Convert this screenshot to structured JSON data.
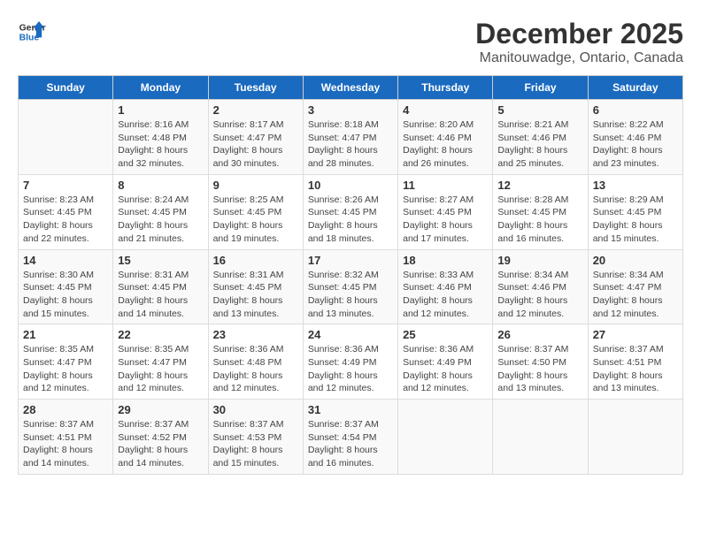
{
  "header": {
    "logo_line1": "General",
    "logo_line2": "Blue",
    "title": "December 2025",
    "subtitle": "Manitouwadge, Ontario, Canada"
  },
  "calendar": {
    "days_of_week": [
      "Sunday",
      "Monday",
      "Tuesday",
      "Wednesday",
      "Thursday",
      "Friday",
      "Saturday"
    ],
    "weeks": [
      [
        {
          "day": "",
          "info": ""
        },
        {
          "day": "1",
          "info": "Sunrise: 8:16 AM\nSunset: 4:48 PM\nDaylight: 8 hours\nand 32 minutes."
        },
        {
          "day": "2",
          "info": "Sunrise: 8:17 AM\nSunset: 4:47 PM\nDaylight: 8 hours\nand 30 minutes."
        },
        {
          "day": "3",
          "info": "Sunrise: 8:18 AM\nSunset: 4:47 PM\nDaylight: 8 hours\nand 28 minutes."
        },
        {
          "day": "4",
          "info": "Sunrise: 8:20 AM\nSunset: 4:46 PM\nDaylight: 8 hours\nand 26 minutes."
        },
        {
          "day": "5",
          "info": "Sunrise: 8:21 AM\nSunset: 4:46 PM\nDaylight: 8 hours\nand 25 minutes."
        },
        {
          "day": "6",
          "info": "Sunrise: 8:22 AM\nSunset: 4:46 PM\nDaylight: 8 hours\nand 23 minutes."
        }
      ],
      [
        {
          "day": "7",
          "info": "Sunrise: 8:23 AM\nSunset: 4:45 PM\nDaylight: 8 hours\nand 22 minutes."
        },
        {
          "day": "8",
          "info": "Sunrise: 8:24 AM\nSunset: 4:45 PM\nDaylight: 8 hours\nand 21 minutes."
        },
        {
          "day": "9",
          "info": "Sunrise: 8:25 AM\nSunset: 4:45 PM\nDaylight: 8 hours\nand 19 minutes."
        },
        {
          "day": "10",
          "info": "Sunrise: 8:26 AM\nSunset: 4:45 PM\nDaylight: 8 hours\nand 18 minutes."
        },
        {
          "day": "11",
          "info": "Sunrise: 8:27 AM\nSunset: 4:45 PM\nDaylight: 8 hours\nand 17 minutes."
        },
        {
          "day": "12",
          "info": "Sunrise: 8:28 AM\nSunset: 4:45 PM\nDaylight: 8 hours\nand 16 minutes."
        },
        {
          "day": "13",
          "info": "Sunrise: 8:29 AM\nSunset: 4:45 PM\nDaylight: 8 hours\nand 15 minutes."
        }
      ],
      [
        {
          "day": "14",
          "info": "Sunrise: 8:30 AM\nSunset: 4:45 PM\nDaylight: 8 hours\nand 15 minutes."
        },
        {
          "day": "15",
          "info": "Sunrise: 8:31 AM\nSunset: 4:45 PM\nDaylight: 8 hours\nand 14 minutes."
        },
        {
          "day": "16",
          "info": "Sunrise: 8:31 AM\nSunset: 4:45 PM\nDaylight: 8 hours\nand 13 minutes."
        },
        {
          "day": "17",
          "info": "Sunrise: 8:32 AM\nSunset: 4:45 PM\nDaylight: 8 hours\nand 13 minutes."
        },
        {
          "day": "18",
          "info": "Sunrise: 8:33 AM\nSunset: 4:46 PM\nDaylight: 8 hours\nand 12 minutes."
        },
        {
          "day": "19",
          "info": "Sunrise: 8:34 AM\nSunset: 4:46 PM\nDaylight: 8 hours\nand 12 minutes."
        },
        {
          "day": "20",
          "info": "Sunrise: 8:34 AM\nSunset: 4:47 PM\nDaylight: 8 hours\nand 12 minutes."
        }
      ],
      [
        {
          "day": "21",
          "info": "Sunrise: 8:35 AM\nSunset: 4:47 PM\nDaylight: 8 hours\nand 12 minutes."
        },
        {
          "day": "22",
          "info": "Sunrise: 8:35 AM\nSunset: 4:47 PM\nDaylight: 8 hours\nand 12 minutes."
        },
        {
          "day": "23",
          "info": "Sunrise: 8:36 AM\nSunset: 4:48 PM\nDaylight: 8 hours\nand 12 minutes."
        },
        {
          "day": "24",
          "info": "Sunrise: 8:36 AM\nSunset: 4:49 PM\nDaylight: 8 hours\nand 12 minutes."
        },
        {
          "day": "25",
          "info": "Sunrise: 8:36 AM\nSunset: 4:49 PM\nDaylight: 8 hours\nand 12 minutes."
        },
        {
          "day": "26",
          "info": "Sunrise: 8:37 AM\nSunset: 4:50 PM\nDaylight: 8 hours\nand 13 minutes."
        },
        {
          "day": "27",
          "info": "Sunrise: 8:37 AM\nSunset: 4:51 PM\nDaylight: 8 hours\nand 13 minutes."
        }
      ],
      [
        {
          "day": "28",
          "info": "Sunrise: 8:37 AM\nSunset: 4:51 PM\nDaylight: 8 hours\nand 14 minutes."
        },
        {
          "day": "29",
          "info": "Sunrise: 8:37 AM\nSunset: 4:52 PM\nDaylight: 8 hours\nand 14 minutes."
        },
        {
          "day": "30",
          "info": "Sunrise: 8:37 AM\nSunset: 4:53 PM\nDaylight: 8 hours\nand 15 minutes."
        },
        {
          "day": "31",
          "info": "Sunrise: 8:37 AM\nSunset: 4:54 PM\nDaylight: 8 hours\nand 16 minutes."
        },
        {
          "day": "",
          "info": ""
        },
        {
          "day": "",
          "info": ""
        },
        {
          "day": "",
          "info": ""
        }
      ]
    ]
  }
}
